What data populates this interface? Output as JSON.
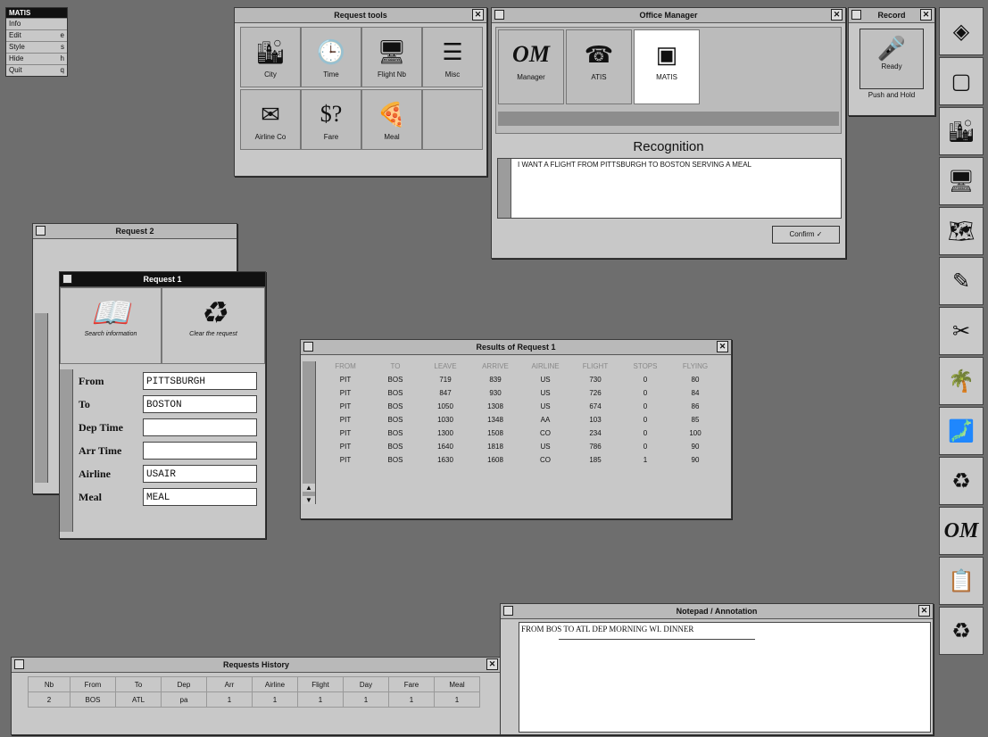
{
  "menu": {
    "title": "MATIS",
    "items": [
      {
        "label": "Info",
        "key": ""
      },
      {
        "label": "Edit",
        "key": "e"
      },
      {
        "label": "Style",
        "key": "s"
      },
      {
        "label": "Hide",
        "key": "h"
      },
      {
        "label": "Quit",
        "key": "q"
      }
    ]
  },
  "request_tools": {
    "title": "Request tools",
    "tools": [
      {
        "label": "City",
        "icon": "city-icon"
      },
      {
        "label": "Time",
        "icon": "clock-icon"
      },
      {
        "label": "Flight Nb",
        "icon": "monitor-icon"
      },
      {
        "label": "Misc",
        "icon": "list-icon"
      },
      {
        "label": "Airline Co",
        "icon": "ticket-icon"
      },
      {
        "label": "Fare",
        "icon": "fare-icon"
      },
      {
        "label": "Meal",
        "icon": "pizza-icon"
      }
    ]
  },
  "office_manager": {
    "title": "Office Manager",
    "apps": [
      {
        "label": "Manager",
        "glyph": "OM"
      },
      {
        "label": "ATIS",
        "glyph": "☎"
      },
      {
        "label": "MATIS",
        "glyph": "▣"
      }
    ]
  },
  "recognition": {
    "title": "Recognition",
    "text": "I WANT A FLIGHT FROM PITTSBURGH TO BOSTON SERVING A MEAL",
    "confirm": "Confirm ✓"
  },
  "record": {
    "title": "Record",
    "button": "Ready",
    "status": "Push and Hold"
  },
  "request2": {
    "title": "Request 2"
  },
  "request1": {
    "title": "Request 1",
    "search": "Search information",
    "clear": "Clear the request",
    "fields": [
      {
        "label": "From",
        "value": "PITTSBURGH"
      },
      {
        "label": "To",
        "value": "BOSTON"
      },
      {
        "label": "Dep Time",
        "value": ""
      },
      {
        "label": "Arr Time",
        "value": ""
      },
      {
        "label": "Airline",
        "value": "USAIR"
      },
      {
        "label": "Meal",
        "value": "MEAL"
      }
    ]
  },
  "results": {
    "title": "Results of Request 1",
    "headers": [
      "FROM",
      "TO",
      "LEAVE",
      "ARRIVE",
      "AIRLINE",
      "FLIGHT",
      "STOPS",
      "FLYING"
    ],
    "rows": [
      [
        "PIT",
        "BOS",
        "719",
        "839",
        "US",
        "730",
        "0",
        "80"
      ],
      [
        "PIT",
        "BOS",
        "847",
        "930",
        "US",
        "726",
        "0",
        "84"
      ],
      [
        "PIT",
        "BOS",
        "1050",
        "1308",
        "US",
        "674",
        "0",
        "86"
      ],
      [
        "PIT",
        "BOS",
        "1030",
        "1348",
        "AA",
        "103",
        "0",
        "85"
      ],
      [
        "PIT",
        "BOS",
        "1300",
        "1508",
        "CO",
        "234",
        "0",
        "100"
      ],
      [
        "PIT",
        "BOS",
        "1640",
        "1818",
        "US",
        "786",
        "0",
        "90"
      ],
      [
        "PIT",
        "BOS",
        "1630",
        "1608",
        "CO",
        "185",
        "1",
        "90"
      ]
    ]
  },
  "history": {
    "title": "Requests History",
    "headers": [
      "Nb",
      "From",
      "To",
      "Dep",
      "Arr",
      "Airline",
      "Flight",
      "Day",
      "Fare",
      "Meal"
    ],
    "rows": [
      [
        "2",
        "BOS",
        "ATL",
        "pa",
        "1",
        "1",
        "1",
        "1",
        "1",
        "1"
      ]
    ]
  },
  "notepad": {
    "title": "Notepad / Annotation",
    "text": "FROM BOS TO ATL DEP MORNING WI. DINNER"
  },
  "dock": [
    "cube-icon",
    "window-icon",
    "city-icon",
    "monitor-icon",
    "globe-icon",
    "edit-icon",
    "tools-icon",
    "palm-icon",
    "map-icon",
    "recycle-icon",
    "om-icon",
    "notes-icon",
    "recycle2-icon"
  ]
}
